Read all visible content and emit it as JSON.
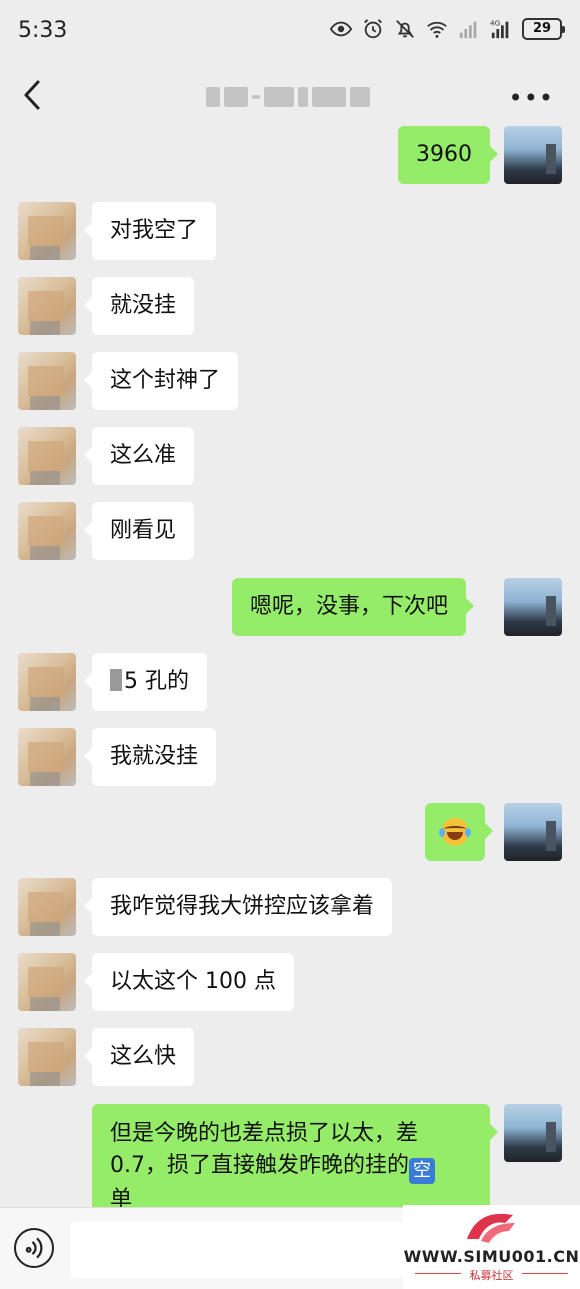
{
  "status_bar": {
    "time": "5:33",
    "battery": "29",
    "network": "4G",
    "icons": [
      "eye-icon",
      "alarm-icon",
      "mute-icon",
      "wifi-icon",
      "signal-icon",
      "signal-4g-icon",
      "battery-icon"
    ]
  },
  "navbar": {
    "back_icon": "chevron-left-icon",
    "title": "",
    "more_label": "•••"
  },
  "messages": [
    {
      "side": "right",
      "text": "3960"
    },
    {
      "side": "left",
      "text": "对我空了"
    },
    {
      "side": "left",
      "text": "就没挂"
    },
    {
      "side": "left",
      "text": "这个封神了"
    },
    {
      "side": "left",
      "text": "这么准"
    },
    {
      "side": "left",
      "text": "刚看见"
    },
    {
      "side": "right",
      "text": "嗯呢，没事，下次吧"
    },
    {
      "side": "left",
      "text": "5 孔的"
    },
    {
      "side": "left",
      "text": "我就没挂"
    },
    {
      "side": "right",
      "text": "",
      "emoji": "laughing-tears-emoji"
    },
    {
      "side": "left",
      "text": "我咋觉得我大饼控应该拿着"
    },
    {
      "side": "left",
      "text": "以太这个 100 点"
    },
    {
      "side": "left",
      "text": "这么快"
    },
    {
      "side": "right",
      "text": "但是今晚的也差点损了以太，差0.7，损了直接触发昨晚的挂的",
      "emoji_text": "空",
      "text_end": "单"
    }
  ],
  "input_bar": {
    "voice_icon": "voice-icon",
    "placeholder": ""
  },
  "watermark": {
    "url": "WWW.SIMU001.CN",
    "sub": "私募社区"
  },
  "colors": {
    "background": "#ededed",
    "bubble_self": "#95ec69",
    "bubble_other": "#ffffff"
  }
}
